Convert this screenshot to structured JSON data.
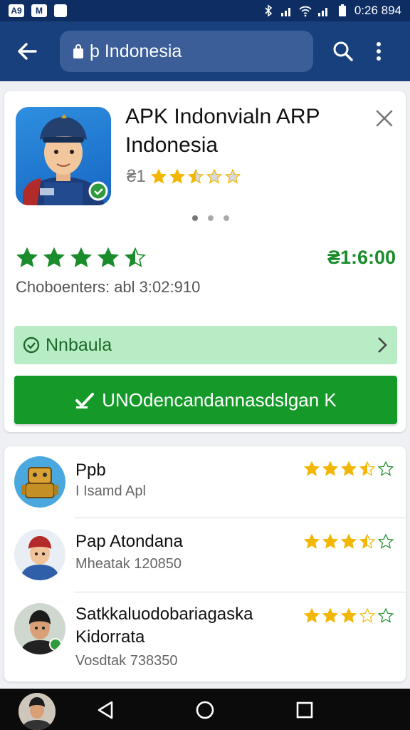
{
  "status_bar": {
    "left_chips": [
      "A9",
      "M"
    ],
    "time": "0:26 894"
  },
  "app_bar": {
    "url_text": "þ Indonesia"
  },
  "app": {
    "title": "APK Indonvialn ARP Indonesia",
    "small_rating_prefix": "₴1",
    "small_rating": 2.5,
    "big_rating": 4.5,
    "price": "₴1:6:00",
    "meta": "Choboenters: abl 3:02:910",
    "status_label": "Nnbaula",
    "install_label": "UNOdencandannasdslgan K"
  },
  "list": {
    "items": [
      {
        "name": "Ppb",
        "sub": "I Isamd Apl",
        "rating": 3.5
      },
      {
        "name": "Pap Atondana",
        "sub": "Mheatak 120850",
        "rating": 3.5
      },
      {
        "name": "Satkkaluodobariagaska Kidorrata",
        "sub": "Vosdtak 738350",
        "rating": 3
      }
    ]
  },
  "colors": {
    "header": "#17407d",
    "status_bar": "#0d2d63",
    "primary_green": "#159a2a",
    "star_yellow": "#f2b705",
    "star_green": "#1a8c2c"
  }
}
